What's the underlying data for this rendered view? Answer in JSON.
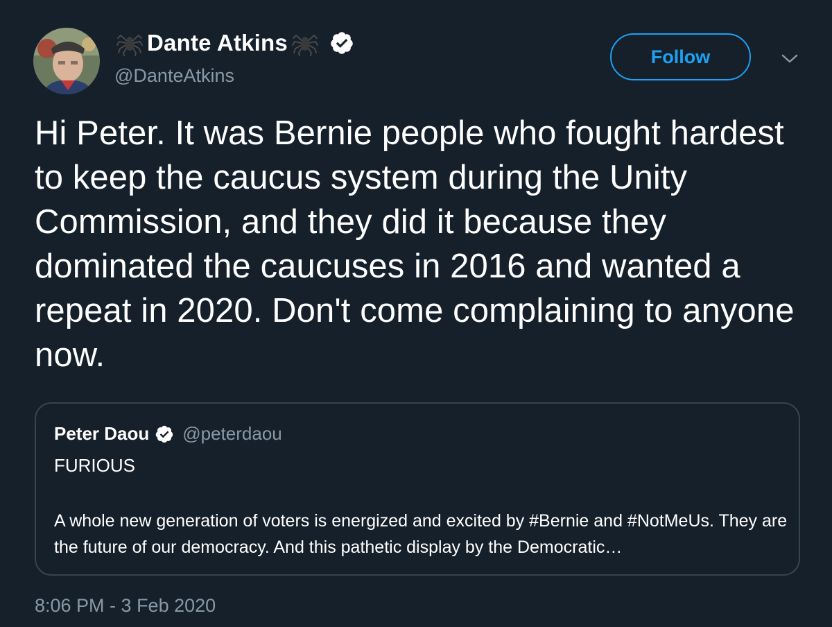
{
  "author": {
    "display_name": "Dante Atkins",
    "handle": "@DanteAtkins",
    "name_decoration_icon": "spider-icon",
    "verified": true
  },
  "actions": {
    "follow_label": "Follow",
    "menu_icon": "chevron-down-icon"
  },
  "tweet": {
    "text": "Hi Peter. It was Bernie people who fought hardest to keep the caucus system during the Unity Commission, and they did it because they dominated the caucuses in 2016 and wanted a repeat in 2020. Don't come complaining to anyone now.",
    "timestamp": "8:06 PM - 3 Feb 2020"
  },
  "quoted_tweet": {
    "display_name": "Peter Daou",
    "handle": "@peterdaou",
    "verified": true,
    "title": "FURIOUS",
    "body": "A whole new generation of voters is energized and excited by #Bernie and #NotMeUs. They are the future of our democracy. And this pathetic display by the Democratic…"
  },
  "colors": {
    "background": "#15202b",
    "text_primary": "#ffffff",
    "text_secondary": "#8899a6",
    "accent": "#1da1f2",
    "border": "#38444d"
  }
}
